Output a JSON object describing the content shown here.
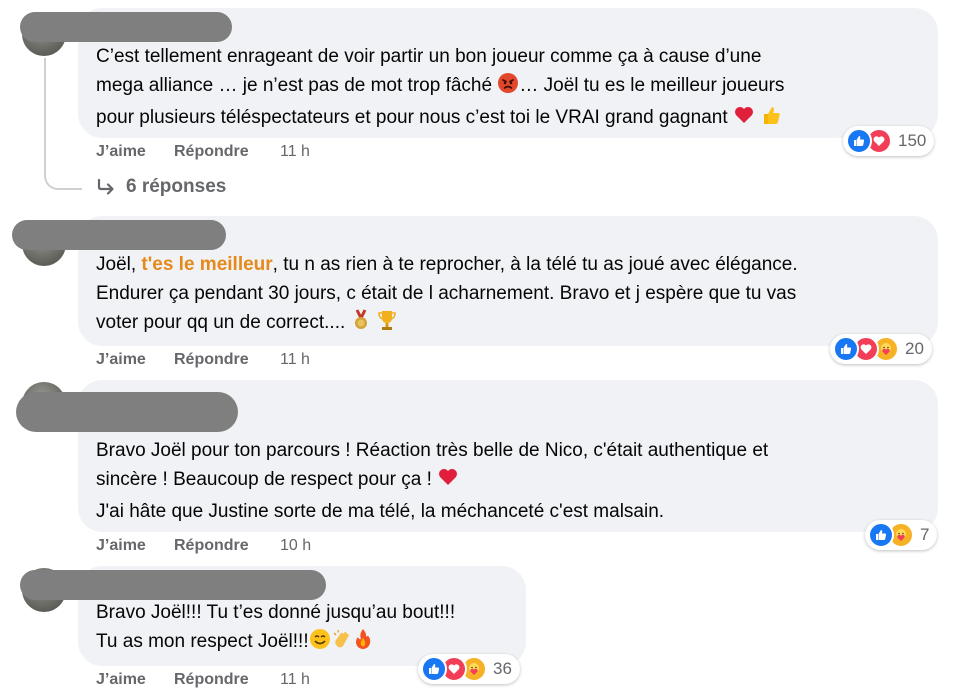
{
  "comments": [
    {
      "lines": [
        "C’est tellement enrageant de voir partir un bon joueur comme ça à cause d’une",
        "mega alliance … je n’est pas de mot trop fâché",
        "… Joël tu es le meilleur joueurs",
        "pour plusieurs téléspectateurs et pour nous c’est toi le VRAI grand gagnant"
      ],
      "actions": {
        "like": "J’aime",
        "reply": "Répondre",
        "time": "11 h"
      },
      "reaction_count": "150",
      "replies_label": "6 réponses"
    },
    {
      "line1_prefix": "Joël, ",
      "line1_highlight": "t'es le meilleur",
      "line1_suffix": ", tu n as rien à te reprocher, à la télé tu as joué avec élégance.",
      "line2": "Endurer ça pendant 30 jours, c était de l acharnement. Bravo et j espère que tu vas",
      "line3": "voter pour qq un de correct....",
      "actions": {
        "like": "J’aime",
        "reply": "Répondre",
        "time": "11 h"
      },
      "reaction_count": "20"
    },
    {
      "lines": [
        "Bravo Joël pour ton parcours ! Réaction très belle de Nico, c'était authentique et",
        "sincère ! Beaucoup de respect pour ça !",
        "J'ai hâte que Justine sorte de ma télé, la méchanceté c'est malsain."
      ],
      "actions": {
        "like": "J’aime",
        "reply": "Répondre",
        "time": "10 h"
      },
      "reaction_count": "7"
    },
    {
      "lines": [
        "Bravo Joël!!! Tu t’es donné jusqu’au bout!!!",
        "Tu as mon respect Joël!!!"
      ],
      "actions": {
        "like": "J’aime",
        "reply": "Répondre",
        "time": "11 h"
      },
      "reaction_count": "36"
    }
  ],
  "colors": {
    "bubble": "#f0f2f5",
    "like": "#1877f2",
    "love": "#f33e58",
    "care": "#f7b125",
    "highlight": "#e6891a",
    "muted": "#65676b"
  },
  "icons": [
    "like-reaction-icon",
    "love-reaction-icon",
    "care-reaction-icon",
    "reply-arrow-icon",
    "angry-face-emoji",
    "heart-emoji",
    "thumbs-up-emoji",
    "medal-emoji",
    "trophy-emoji",
    "smile-emoji",
    "clap-emoji",
    "fire-emoji"
  ]
}
